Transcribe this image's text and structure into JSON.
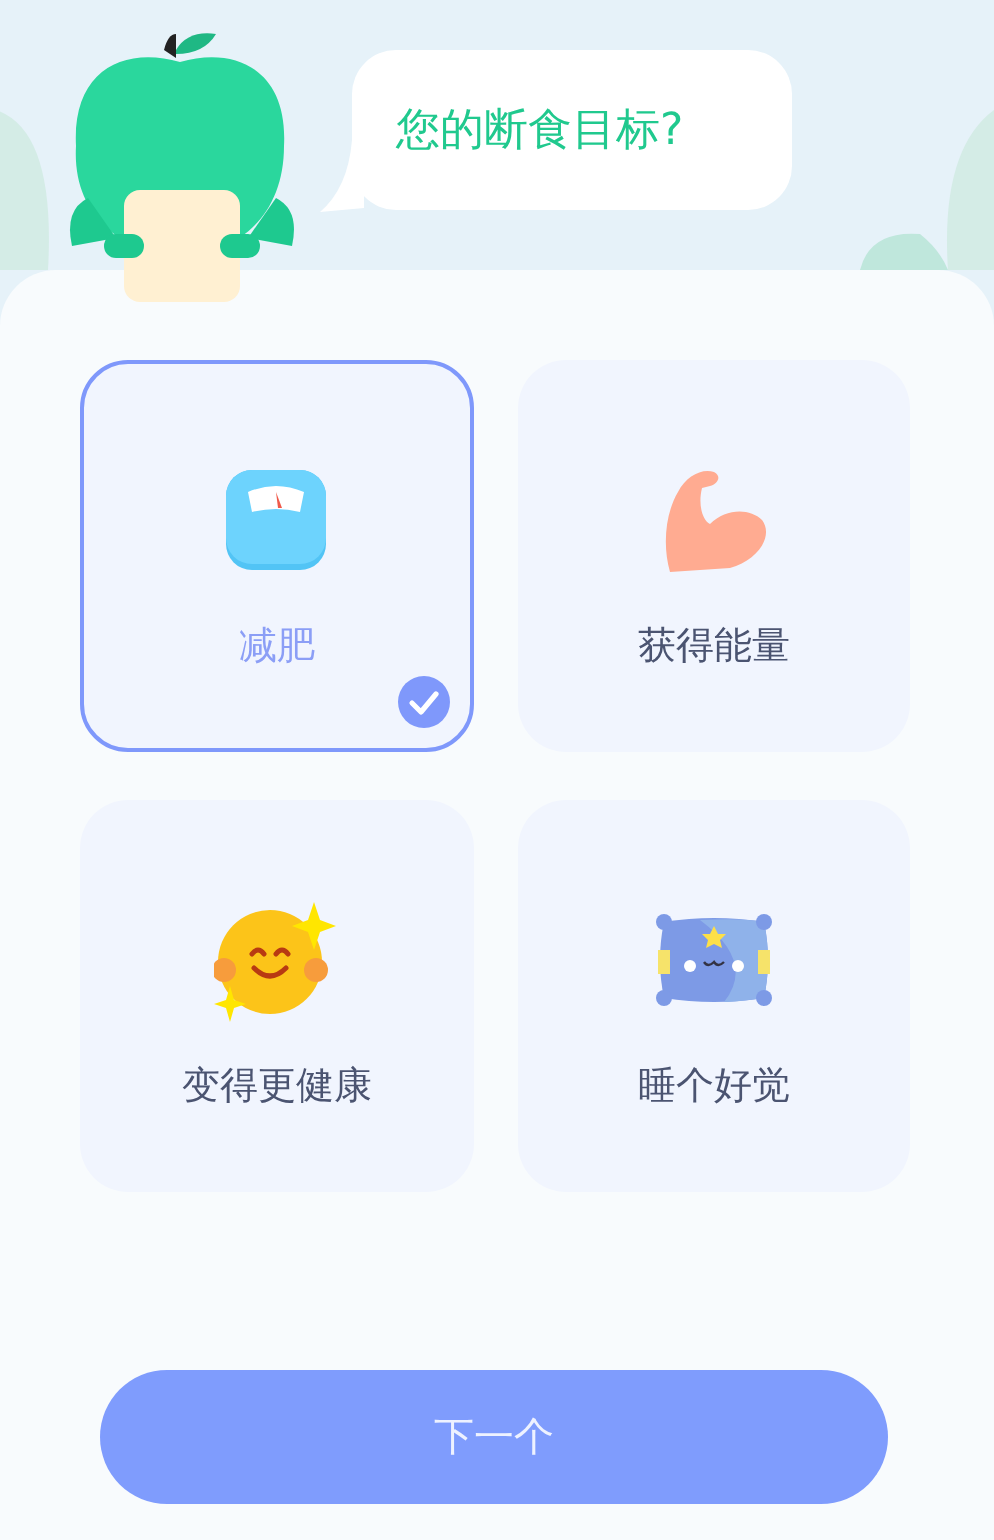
{
  "question": "您的断食目标?",
  "options": [
    {
      "label": "减肥",
      "kind": "scale",
      "selected": true
    },
    {
      "label": "获得能量",
      "kind": "muscle",
      "selected": false
    },
    {
      "label": "变得更健康",
      "kind": "smiley",
      "selected": false
    },
    {
      "label": "睡个好觉",
      "kind": "pillow",
      "selected": false
    }
  ],
  "next_button": {
    "label": "下一个",
    "disabled": true
  }
}
